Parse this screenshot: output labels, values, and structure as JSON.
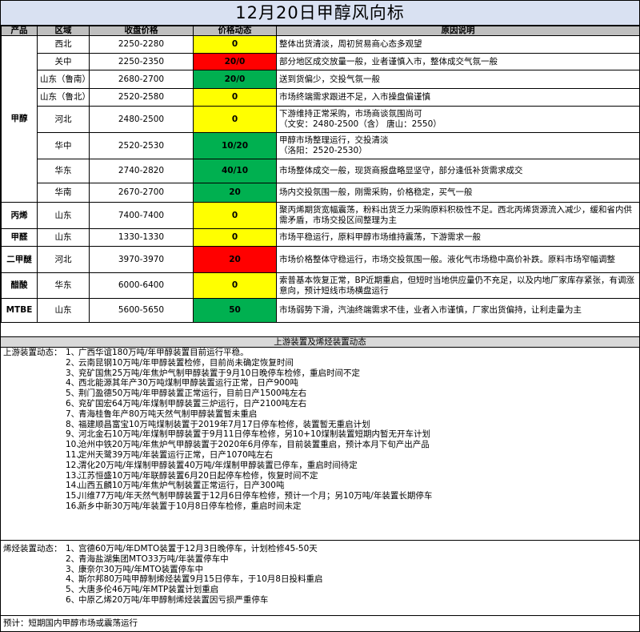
{
  "title": "12月20日甲醇风向标",
  "headers": {
    "product": "产品",
    "region": "区域",
    "price": "收盘价格",
    "trend": "价格动态",
    "reason": "原因说明"
  },
  "rows": [
    {
      "product": "甲醇",
      "region": "西北",
      "price": "2250-2280",
      "trend": "0",
      "trend_color": "#ffff00",
      "reason": "整体出货清淡，周初贸易商心态多观望"
    },
    {
      "product": "",
      "region": "关中",
      "price": "2250-2350",
      "trend": "20/0",
      "trend_color": "#ff0000",
      "reason": "部分地区成交放量一般，业者谨慎入市，整体成交气氛一般"
    },
    {
      "product": "",
      "region": "山东（鲁南）",
      "price": "2680-2700",
      "trend": "20/0",
      "trend_color": "#00b050",
      "reason": "送到货偏少，交投气氛一般"
    },
    {
      "product": "",
      "region": "山东（鲁北）",
      "price": "2520-2580",
      "trend": "0",
      "trend_color": "#ffff00",
      "reason": "市场终端需求跟进不足，入市操盘偏谨慎"
    },
    {
      "product": "",
      "region": "河北",
      "price": "2480-2500",
      "trend": "0",
      "trend_color": "#ffff00",
      "reason": "下游维持正常采购，市场商谈氛围尚可\n（文安：2480-2500（含） 唐山：2550）"
    },
    {
      "product": "",
      "region": "华中",
      "price": "2520-2530",
      "trend": "10/20",
      "trend_color": "#00b050",
      "reason": "甲醇市场整理运行，交投清淡\n（洛阳：2520-2530）"
    },
    {
      "product": "",
      "region": "华东",
      "price": "2740-2820",
      "trend": "40/10",
      "trend_color": "#00b050",
      "reason": "市场整体成交一般，现货商报盘略显坚守，部分逢低补货需求成交"
    },
    {
      "product": "",
      "region": "华南",
      "price": "2670-2700",
      "trend": "20",
      "trend_color": "#00b050",
      "reason": "场内交投氛围一般，刚需采购，价格稳定，买气一般"
    },
    {
      "product": "丙烯",
      "region": "山东",
      "price": "7400-7400",
      "trend": "0",
      "trend_color": "#ffff00",
      "reason": "聚丙烯期货宽幅震荡，粉料出货乏力采购原料积极性不足。西北丙烯货源流入减少，缓和省内供需矛盾，市场交投区间整理为主"
    },
    {
      "product": "甲醛",
      "region": "山东",
      "price": "1330-1330",
      "trend": "0",
      "trend_color": "#ffff00",
      "reason": "市场平稳运行，原料甲醇市场维持震荡，下游需求一般"
    },
    {
      "product": "二甲醚",
      "region": "河北",
      "price": "3970-3970",
      "trend": "20",
      "trend_color": "#ff0000",
      "reason": "市场价格整体守稳运行，市场交投氛围一般。液化气市场稳中高价补跌。原料市场窄幅调整"
    },
    {
      "product": "醋酸",
      "region": "华东",
      "price": "6000-6400",
      "trend": "0",
      "trend_color": "#ffff00",
      "reason": "索普基本恢复正常，BP近期重启，但短时当地供应量仍不充足，以及内地厂家库存紧张，有调涨意向，预计短线市场横盘运行"
    },
    {
      "product": "MTBE",
      "region": "山东",
      "price": "5600-5650",
      "trend": "50",
      "trend_color": "#00b050",
      "reason": "市场弱势下滑，汽油终端需求不佳，业者入市谨慎，厂家出货偏持，让利走量为主"
    }
  ],
  "section_title": "上游装置及烯烃装置动态",
  "upstream": {
    "label": "上游装置动态：",
    "items": [
      "广西华谊180万吨/年甲醇装置目前运行平稳。",
      "云南昆钢10万吨/年甲醇装置检修，目前尚未确定恢复时间",
      "兖矿国焦25万吨/年焦炉气制甲醇装置于9月10日晚停车检修，重启时间不定",
      "西北能源其年产30万吨煤制甲醇装置运行正常，日产900吨",
      "荆门盈德50万吨/年甲醇装置正常运行，目前日产1500吨左右",
      "兖矿国宏64万吨/年煤制甲醇装置三炉运行，日产2100吨左右",
      "青海桂鲁年产80万吨天然气制甲醇装置暂未重启",
      "福建顺昌富宝10万吨煤制装置于2019年7月17日停车检修，装置暂无重启计划",
      "河北金石10万吨/年煤制甲醇装置于9月11日停车检修，另10+10煤制装置短期内暂无开车计划",
      "沧州中铁20万吨/年焦炉气甲醇装置于2020年6月停车，目前装置重启，预计本月下旬产出产品",
      "定州天鹭39万吨/年装置运行正常，日产1070吨左右",
      "渭化20万吨/年煤制甲醇装置40万吨/年煤制甲醇装置已停车，重启时间待定",
      "江苏恒盛10万吨/年联醇装置6月20日起停车检修，恢复时间不定",
      "山西五麟10万吨/年焦炉气制装置正常运行，日产300吨",
      "川维77万吨/年天然气制甲醇装置于12月6日停车检修，预计一个月；另10万吨/年装置长期停车",
      "新乡中新30万吨/年装置于10月8日停车检修，重启时间未定"
    ]
  },
  "olefin": {
    "label": "烯烃装置动态：",
    "items": [
      "宫德60万吨/年DMTO装置于12月3日晚停车，计划检修45-50天",
      "青海盐湖集团MTO33万吨/年装置停车中",
      "康奈尔30万吨/年MTO装置停车中",
      "斯尔邦80万吨甲醇制烯烃装置9月15日停车，于10月8日投料重启",
      "大唐多伦46万吨/年MTP装置计划重启",
      "中原乙烯20万吨/年甲醇制烯烃装置因亏损严重停车"
    ]
  },
  "forecast": "预计：短期国内甲醇市场或震荡运行"
}
